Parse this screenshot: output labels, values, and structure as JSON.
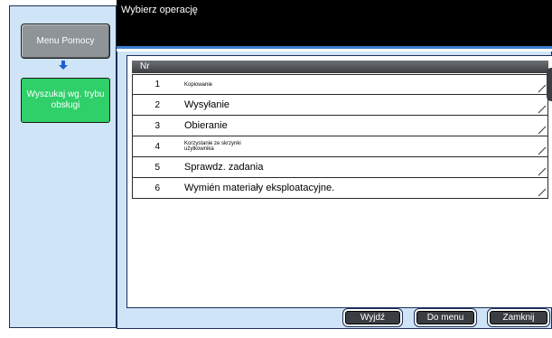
{
  "sidebar": {
    "menu_button": "Menu Pomocy",
    "search_button": "Wyszukaj wg. trybu obsługi"
  },
  "header": {
    "title": "Wybierz operację"
  },
  "table": {
    "header": "Nr",
    "rows": [
      {
        "num": "1",
        "label": "Kopiowanie"
      },
      {
        "num": "2",
        "label": "Wysyłanie"
      },
      {
        "num": "3",
        "label": "Obieranie"
      },
      {
        "num": "4",
        "label": "Korzystanie ze skrzynki użytkownika"
      },
      {
        "num": "5",
        "label": "Sprawdz. zadania"
      },
      {
        "num": "6",
        "label": "Wymién materiały eksploatacyjne."
      }
    ]
  },
  "footer": {
    "exit": "Wyjdź",
    "to_menu": "Do menu",
    "close": "Zamknij"
  },
  "colors": {
    "panel": "#cfe5f7",
    "header": "#000000",
    "accent": "#3d7fd2",
    "search_button": "#2fcf69"
  }
}
